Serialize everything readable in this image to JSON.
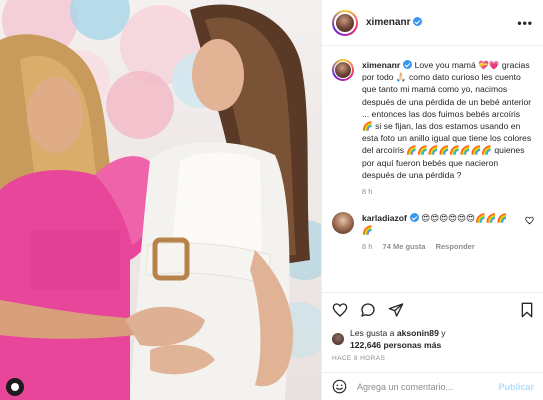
{
  "post": {
    "username": "ximenanr",
    "caption_text": " Love you mamá 💝💗 gracias por todo 🙏🏻 como dato curioso les cuento que tanto mi mamá como yo, nacimos después de una pérdida de un bebé anterior ... entonces las dos fuimos bebés arcoíris 🌈 si se fijan, las dos estamos usando en esta foto un anillo igual que tiene los colores del arcoíris 🌈🌈🌈🌈🌈🌈🌈🌈 quienes por aquí fueron bebés que nacieron después de una pérdida ?",
    "caption_time": "8 h"
  },
  "reply": {
    "username": "karladiazof",
    "text": "😍😍😍😍😍😍🌈🌈🌈🌈",
    "time": "8 h",
    "likes": "74 Me gusta",
    "reply_label": "Responder"
  },
  "likes": {
    "prefix": "Les gusta a ",
    "user": "aksonin89",
    "middle": " y",
    "count": "122,646 personas más"
  },
  "timestamp": "HACE 8 HORAS",
  "comment": {
    "placeholder": "Agrega un comentario...",
    "publish_label": "Publicar"
  },
  "header": {
    "more": "•••"
  },
  "icons": [
    "more-options-icon",
    "heart-icon",
    "comment-icon",
    "share-icon",
    "save-icon",
    "emoji-icon",
    "verified-icon"
  ]
}
